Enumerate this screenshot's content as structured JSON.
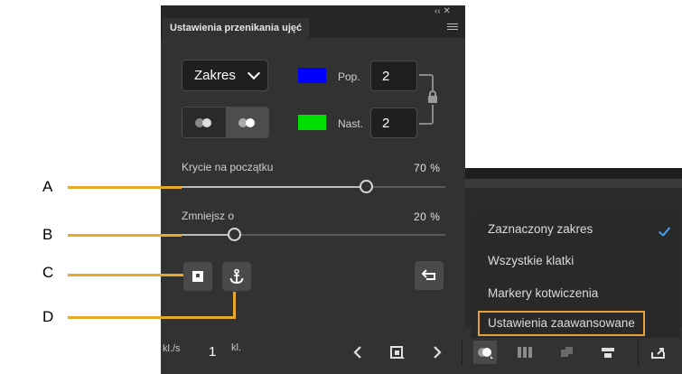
{
  "panel": {
    "title": "Ustawienia przenikania ujęć",
    "top_controls": "‹‹  ✕",
    "range_dropdown": "Zakres",
    "prev_label": "Pop.",
    "prev_value": "2",
    "next_label": "Nast.",
    "next_value": "2",
    "prev_color": "#0000ff",
    "next_color": "#00e000",
    "opacity_label": "Krycie na początku",
    "opacity_value": "70",
    "opacity_unit": "%",
    "opacity_level": 0.7,
    "reduce_label": "Zmniejsz o",
    "reduce_value": "20",
    "reduce_unit": "%",
    "reduce_level": 0.2
  },
  "menu": {
    "items": [
      "Zaznaczony zakres",
      "Wszystkie klatki",
      "Markery kotwiczenia",
      "Ustawienia zaawansowane"
    ],
    "checked_index": 0,
    "highlight_color": "#e8a038"
  },
  "bottombar": {
    "fps_unit": "kl./s",
    "frame_value": "1",
    "frame_unit": "kl."
  },
  "callouts": [
    "A",
    "B",
    "C",
    "D"
  ],
  "colors": {
    "accent": "#4d9ee8",
    "callout_line": "#e8a82a"
  }
}
